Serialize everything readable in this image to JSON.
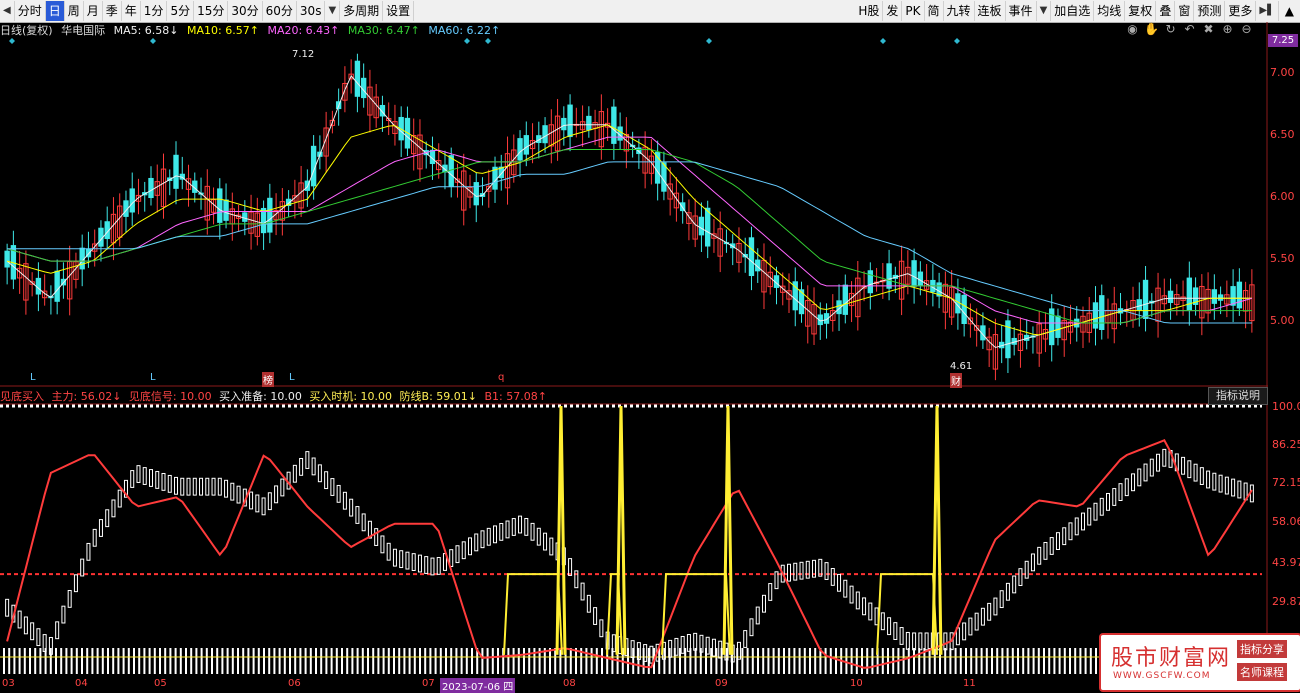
{
  "toolbar": {
    "left_items": [
      "分时",
      "日",
      "周",
      "月",
      "季",
      "年",
      "1分",
      "5分",
      "15分",
      "30分",
      "60分",
      "30s",
      "多周期",
      "设置"
    ],
    "active_item": "日",
    "right_items": [
      "H股",
      "发",
      "PK",
      "简",
      "九转",
      "连板",
      "事件",
      "加自选",
      "均线",
      "复权",
      "叠",
      "窗",
      "预测",
      "更多"
    ]
  },
  "main_header": {
    "title": "日线(复权)",
    "stock": "华电国际",
    "ma5": "MA5: 6.58↓",
    "ma10": "MA10: 6.57↑",
    "ma20": "MA20: 6.43↑",
    "ma30": "MA30: 6.47↑",
    "ma60": "MA60: 6.22↑"
  },
  "current_price_tag": "7.25",
  "price_axis": [
    "7.00",
    "6.50",
    "6.00",
    "5.50",
    "5.00"
  ],
  "annotations": {
    "high": "7.12",
    "low": "4.61",
    "marker_bang": "榜",
    "marker_cai": "财",
    "marker_q": "q",
    "marker_l": "L"
  },
  "indicator_header": {
    "name": "见底买入",
    "zhuli": "主力: 56.02↓",
    "jiandi": "见底信号: 10.00",
    "zhunbei": "买入准备: 10.00",
    "shiji": "买入时机: 10.00",
    "fangxian": "防线B: 59.01↓",
    "b1": "B1: 57.08↑",
    "button": "指标说明"
  },
  "indicator_axis": [
    "100.00",
    "86.25",
    "72.15",
    "58.06",
    "43.97",
    "29.87"
  ],
  "dates": {
    "months": [
      "03",
      "04",
      "05",
      "06",
      "07",
      "08",
      "09",
      "10",
      "11"
    ],
    "selected": "2023-07-06 四"
  },
  "watermark": {
    "title": "股市财富网",
    "url": "WWW.GSCFW.COM",
    "tag1": "指标分享",
    "tag2": "名师课程"
  },
  "chart_data": {
    "type": "candlestick",
    "title": "日线(复权) 华电国际",
    "price_axis_range": [
      4.5,
      7.3
    ],
    "indicator_range": [
      20,
      100
    ],
    "ma_series": [
      {
        "name": "MA5",
        "color": "#f0f0f0",
        "values": [
          5.5,
          5.2,
          5.6,
          6.0,
          6.2,
          5.9,
          5.8,
          6.1,
          7.0,
          6.6,
          6.3,
          6.0,
          6.4,
          6.6,
          6.6,
          6.3,
          5.8,
          5.6,
          5.3,
          5.0,
          5.3,
          5.4,
          5.2,
          4.8,
          4.9,
          5.0,
          5.1,
          5.2,
          5.2,
          5.2
        ]
      },
      {
        "name": "MA10",
        "color": "#ffff00",
        "values": [
          5.5,
          5.4,
          5.5,
          5.8,
          6.0,
          6.0,
          5.9,
          6.0,
          6.5,
          6.6,
          6.4,
          6.2,
          6.3,
          6.5,
          6.6,
          6.4,
          6.0,
          5.7,
          5.4,
          5.1,
          5.2,
          5.3,
          5.2,
          5.0,
          4.9,
          5.0,
          5.1,
          5.1,
          5.2,
          5.2
        ]
      },
      {
        "name": "MA20",
        "color": "#ff66ff",
        "values": [
          5.6,
          5.5,
          5.5,
          5.6,
          5.8,
          5.9,
          5.9,
          5.9,
          6.1,
          6.3,
          6.4,
          6.3,
          6.3,
          6.4,
          6.5,
          6.5,
          6.2,
          5.9,
          5.6,
          5.3,
          5.3,
          5.3,
          5.3,
          5.1,
          5.0,
          5.0,
          5.0,
          5.1,
          5.1,
          5.2
        ]
      },
      {
        "name": "MA30",
        "color": "#33cc33",
        "values": [
          5.6,
          5.5,
          5.5,
          5.6,
          5.7,
          5.8,
          5.8,
          5.9,
          6.0,
          6.1,
          6.2,
          6.3,
          6.3,
          6.4,
          6.4,
          6.4,
          6.3,
          6.1,
          5.8,
          5.5,
          5.4,
          5.3,
          5.3,
          5.2,
          5.1,
          5.0,
          5.0,
          5.1,
          5.1,
          5.1
        ]
      },
      {
        "name": "MA60",
        "color": "#66ccff",
        "values": [
          5.6,
          5.6,
          5.6,
          5.6,
          5.7,
          5.7,
          5.8,
          5.8,
          5.9,
          6.0,
          6.1,
          6.1,
          6.2,
          6.2,
          6.3,
          6.3,
          6.3,
          6.2,
          6.1,
          5.9,
          5.7,
          5.6,
          5.4,
          5.3,
          5.2,
          5.1,
          5.1,
          5.0,
          5.0,
          5.0
        ]
      }
    ],
    "indicator_series": [
      {
        "name": "主力",
        "color": "#ffffff",
        "values": [
          40,
          28,
          60,
          80,
          76,
          76,
          70,
          84,
          70,
          55,
          52,
          60,
          65,
          55,
          30,
          26,
          30,
          26,
          50,
          52,
          40,
          30,
          30,
          40,
          55,
          65,
          75,
          85,
          78,
          74
        ]
      },
      {
        "name": "防线B",
        "color": "#ff3333",
        "values": [
          30,
          80,
          86,
          70,
          73,
          55,
          86,
          70,
          58,
          65,
          65,
          25,
          26,
          28,
          25,
          22,
          55,
          76,
          52,
          26,
          22,
          25,
          30,
          60,
          72,
          70,
          85,
          90,
          55,
          75
        ]
      }
    ]
  }
}
